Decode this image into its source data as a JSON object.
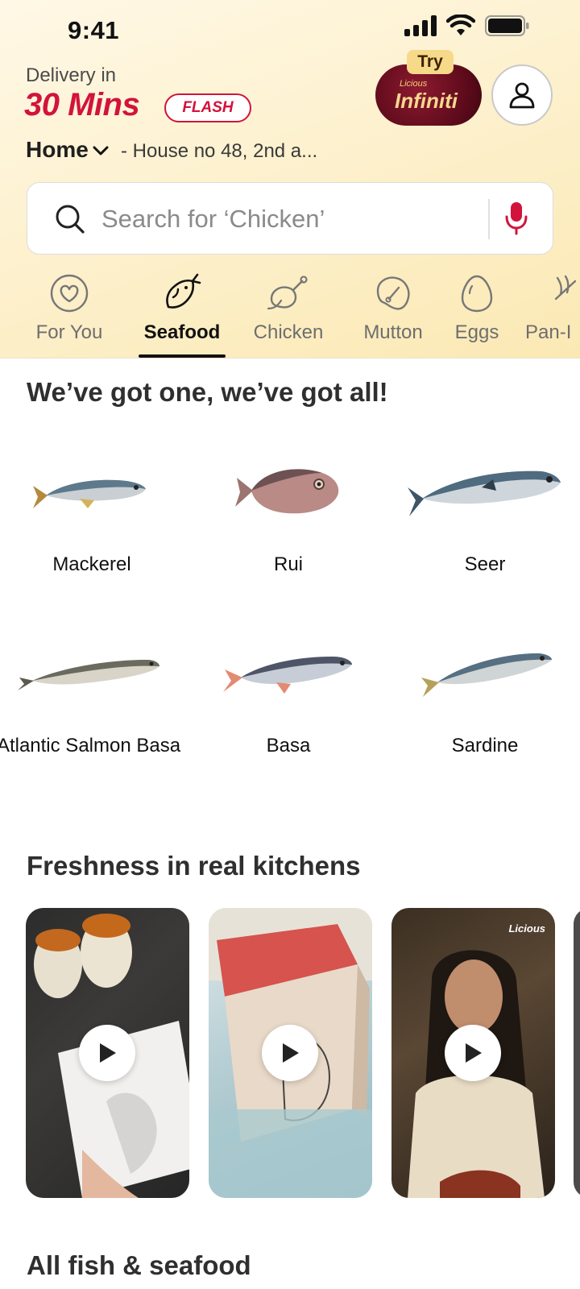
{
  "status_bar": {
    "time": "9:41"
  },
  "header": {
    "delivery_label": "Delivery in",
    "delivery_time": "30 Mins",
    "flash_badge": "FLASH",
    "try_badge": "Try",
    "infiniti_brand": "Licious",
    "infiniti_name": "Infiniti",
    "address_label": "Home",
    "address_text": "- House no 48, 2nd a..."
  },
  "search": {
    "placeholder": "Search for ‘Chicken’"
  },
  "categories": [
    {
      "label": "For You",
      "icon": "heart-circle-icon",
      "active": false
    },
    {
      "label": "Seafood",
      "icon": "fish-icon",
      "active": true
    },
    {
      "label": "Chicken",
      "icon": "chicken-icon",
      "active": false
    },
    {
      "label": "Mutton",
      "icon": "mutton-icon",
      "active": false
    },
    {
      "label": "Eggs",
      "icon": "egg-icon",
      "active": false
    },
    {
      "label": "Pan-I",
      "icon": "pan-icon",
      "active": false
    }
  ],
  "section_fish": {
    "title": "We’ve got one, we’ve got all!",
    "items": [
      {
        "name": "Mackerel"
      },
      {
        "name": "Rui"
      },
      {
        "name": "Seer"
      },
      {
        "name": "Atlantic Salmon Basa"
      },
      {
        "name": "Basa"
      },
      {
        "name": "Sardine"
      }
    ]
  },
  "section_videos": {
    "title": "Freshness in real kitchens",
    "brand_tag": "Licious"
  },
  "section_all": {
    "title": "All fish & seafood"
  },
  "colors": {
    "brand_red": "#d2133c",
    "header_bg": "#fdf1cf",
    "infiniti_maroon": "#5a0a1a"
  }
}
